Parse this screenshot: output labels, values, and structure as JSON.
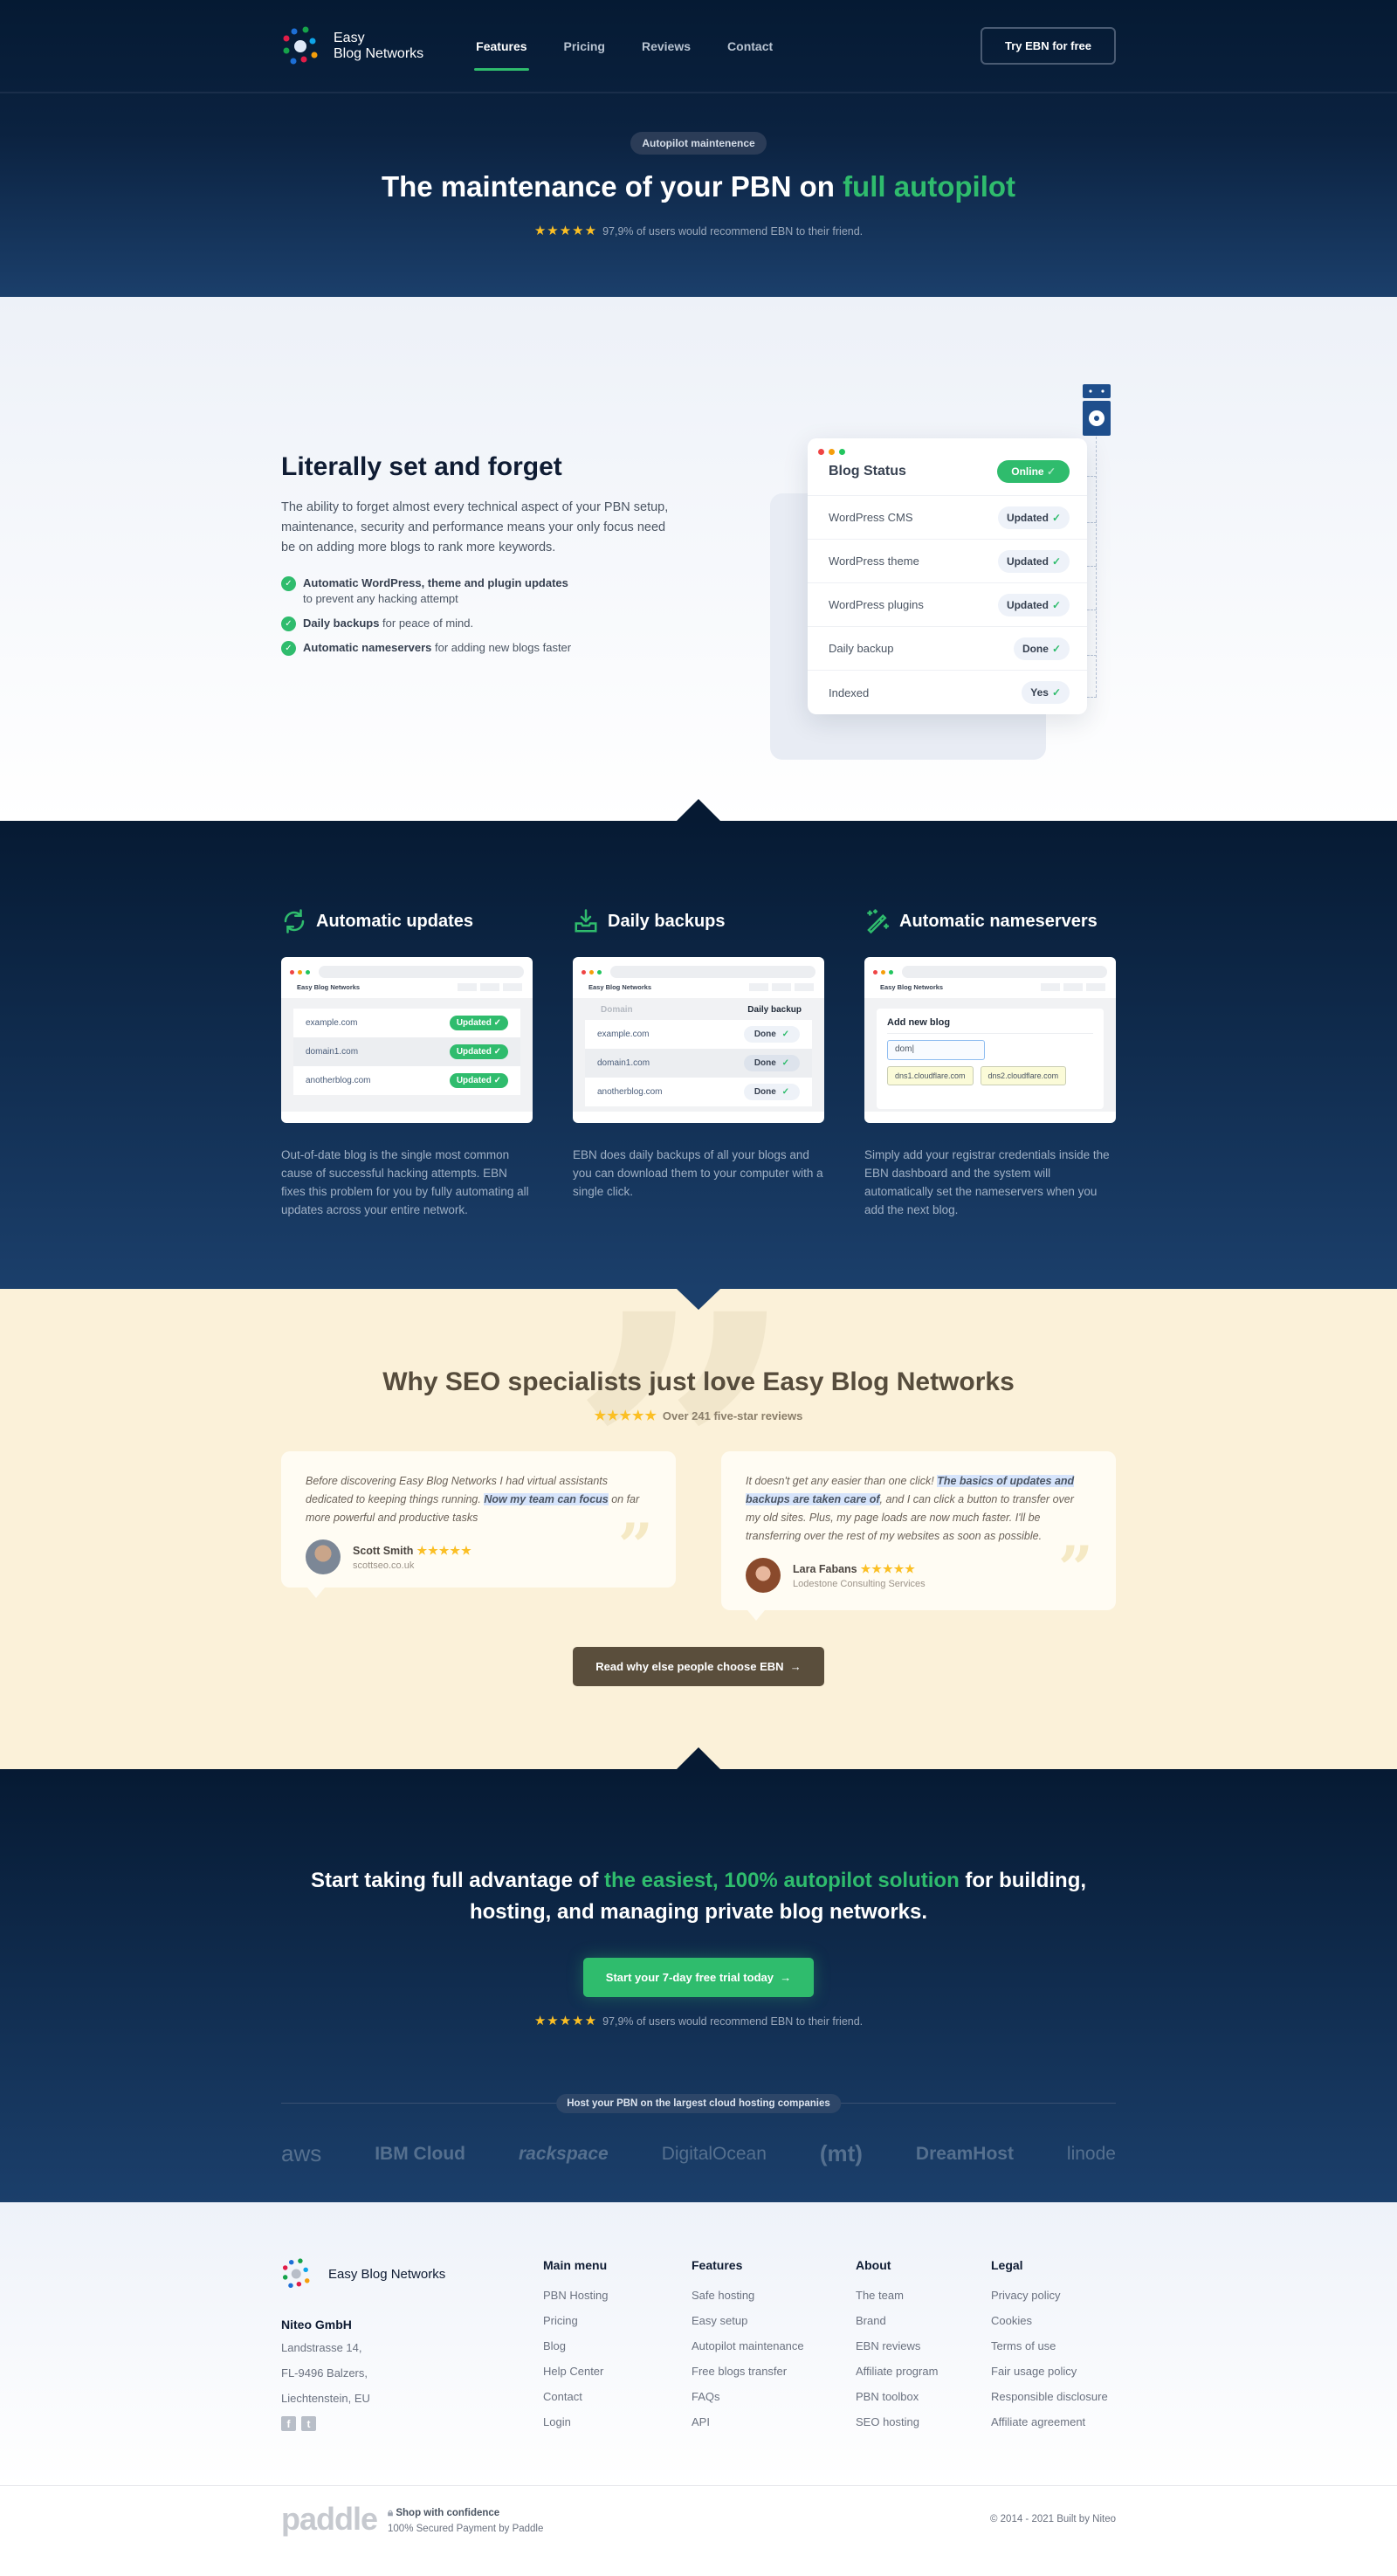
{
  "header": {
    "brand_line1": "Easy",
    "brand_line2": "Blog Networks",
    "nav": [
      {
        "label": "Features",
        "active": true
      },
      {
        "label": "Pricing",
        "active": false
      },
      {
        "label": "Reviews",
        "active": false
      },
      {
        "label": "Contact",
        "active": false
      }
    ],
    "cta_label": "Try EBN for free"
  },
  "hero": {
    "pill": "Autopilot maintenence",
    "title_main": "The maintenance of your PBN on ",
    "title_accent": "full autopilot",
    "stars": "★★★★★",
    "rating_text": "97,9% of users would recommend EBN to their friend."
  },
  "feature": {
    "title": "Literally set and forget",
    "description": "The ability to forget almost every technical aspect of your PBN setup, maintenance, security and performance means your only focus need be on adding more blogs to rank more keywords.",
    "checks": [
      {
        "bold": "Automatic WordPress, theme and plugin updates",
        "rest": "to prevent any hacking attempt"
      },
      {
        "bold": "Daily backups",
        "rest": " for peace of mind."
      },
      {
        "bold": "Automatic nameservers",
        "rest": " for adding new blogs faster"
      }
    ],
    "status_card": {
      "title": "Blog Status",
      "status": "Online",
      "rows": [
        {
          "label": "WordPress CMS",
          "value": "Updated"
        },
        {
          "label": "WordPress theme",
          "value": "Updated"
        },
        {
          "label": "WordPress plugins",
          "value": "Updated"
        },
        {
          "label": "Daily backup",
          "value": "Done"
        },
        {
          "label": "Indexed",
          "value": "Yes"
        }
      ]
    }
  },
  "features3": {
    "mock_brand": "Easy Blog Networks",
    "updates": {
      "title": "Automatic updates",
      "rows": [
        {
          "domain": "example.com",
          "status": "Updated"
        },
        {
          "domain": "domain1.com",
          "status": "Updated"
        },
        {
          "domain": "anotherblog.com",
          "status": "Updated"
        }
      ],
      "text": "Out-of-date blog is the single most common cause of successful hacking attempts. EBN fixes this problem for you by fully automating all updates across your entire network."
    },
    "backups": {
      "title": "Daily backups",
      "col_domain": "Domain",
      "col_backup": "Daily backup",
      "rows": [
        {
          "domain": "example.com",
          "status": "Done"
        },
        {
          "domain": "domain1.com",
          "status": "Done"
        },
        {
          "domain": "anotherblog.com",
          "status": "Done"
        }
      ],
      "text": "EBN does daily backups of all your blogs and you can download them to your computer with a single click."
    },
    "nameservers": {
      "title": "Automatic nameservers",
      "form_title": "Add new blog",
      "input_value": "dom",
      "dns": [
        "dns1.cloudflare.com",
        "dns2.cloudflare.com"
      ],
      "text": "Simply add your registrar credentials inside the EBN dashboard and the system will automatically set the nameservers when you add the next blog."
    }
  },
  "reviews": {
    "title": "Why SEO specialists just love Easy Blog Networks",
    "stars": "★★★★★",
    "subtitle": "Over 241 five-star reviews",
    "items": [
      {
        "pre": "Before discovering Easy Blog Networks I had virtual assistants dedicated to keeping things running. ",
        "highlight": "Now my team can focus",
        "post": " on far more powerful and productive tasks",
        "name": "Scott Smith",
        "stars": "★★★★★",
        "company": "scottseo.co.uk"
      },
      {
        "pre": "It doesn't get any easier than one click! ",
        "highlight": "The basics of updates and backups are taken care of",
        "post": ", and I can click a button to transfer over my old sites. Plus, my page loads are now much faster. I'll be transferring over the rest of my websites as soon as possible.",
        "name": "Lara Fabans",
        "stars": "★★★★★",
        "company": "Lodestone Consulting Services"
      }
    ],
    "button_label": "Read why else people choose EBN",
    "arrow": "→"
  },
  "cta": {
    "title_pre": "Start taking full advantage of ",
    "title_accent": "the easiest, 100% autopilot solution",
    "title_post": " for building, hosting, and managing private blog networks.",
    "button_label": "Start your 7-day free trial today",
    "arrow": "→",
    "stars": "★★★★★",
    "rating_text": "97,9% of users would recommend EBN to their friend.",
    "hosting_label": "Host your PBN on the largest cloud hosting companies",
    "providers": [
      "aws",
      "IBM Cloud",
      "rackspace",
      "DigitalOcean",
      "(mt)",
      "DreamHost",
      "linode"
    ]
  },
  "footer": {
    "brand": "Easy Blog Networks",
    "company": "Niteo GmbH",
    "address": [
      "Landstrasse 14,",
      "FL-9496 Balzers,",
      "Liechtenstein, EU"
    ],
    "columns": [
      {
        "title": "Main menu",
        "links": [
          "PBN Hosting",
          "Pricing",
          "Blog",
          "Help Center",
          "Contact",
          "Login"
        ]
      },
      {
        "title": "Features",
        "links": [
          "Safe hosting",
          "Easy setup",
          "Autopilot maintenance",
          "Free blogs transfer",
          "FAQs",
          "API"
        ]
      },
      {
        "title": "About",
        "links": [
          "The team",
          "Brand",
          "EBN reviews",
          "Affiliate program",
          "PBN toolbox",
          "SEO hosting"
        ]
      },
      {
        "title": "Legal",
        "links": [
          "Privacy policy",
          "Cookies",
          "Terms of use",
          "Fair usage policy",
          "Responsible disclosure",
          "Affiliate agreement"
        ]
      }
    ],
    "paddle": "paddle",
    "shop_title": "Shop with confidence",
    "shop_sub": "100% Secured Payment by Paddle",
    "copyright": "© 2014 - 2021 Built by Niteo"
  },
  "colors": {
    "accent": "#2fbc6d",
    "navy": "#061a33",
    "cream": "#fbf1d9",
    "star": "#fbbf24"
  }
}
